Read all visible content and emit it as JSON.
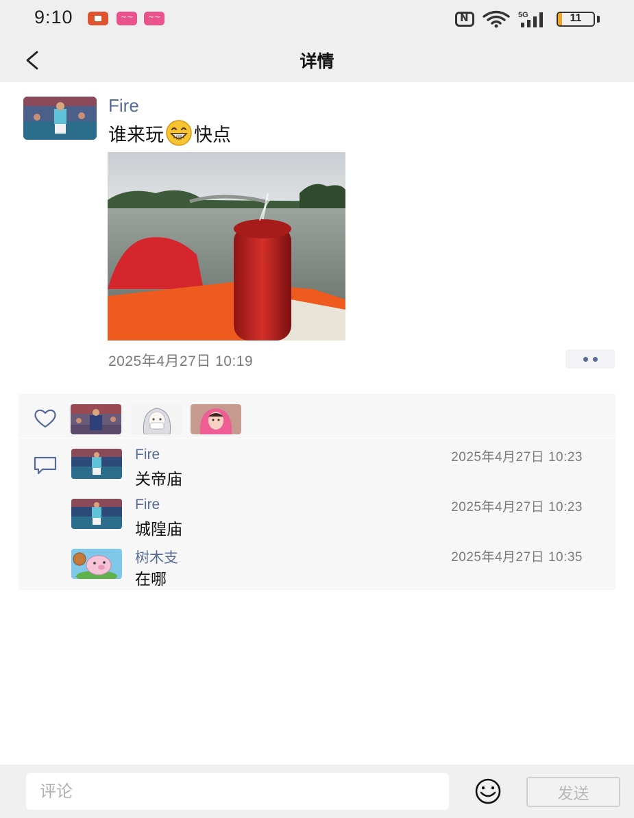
{
  "status_bar": {
    "time": "9:10",
    "network": "5G",
    "battery": {
      "level_text": "11",
      "level_percent": 11
    }
  },
  "nav": {
    "title": "详情"
  },
  "post": {
    "author": "Fire",
    "text_before": "谁来玩",
    "emoji": "grinning-emoji-icon",
    "text_after": "快点",
    "time": "2025年4月27日 10:19"
  },
  "likes": {
    "icon": "heart-icon",
    "avatars": [
      "crowd-avatar",
      "anime-avatar",
      "pink-hoodie-avatar"
    ]
  },
  "comments": [
    {
      "author": "Fire",
      "time": "2025年4月27日 10:23",
      "text": "关帝庙"
    },
    {
      "author": "Fire",
      "time": "2025年4月27日 10:23",
      "text": "城隍庙"
    },
    {
      "author": "树木支",
      "time": "2025年4月27日 10:35",
      "text": "在哪"
    }
  ],
  "input_bar": {
    "placeholder": "评论",
    "send_label": "发送"
  },
  "colors": {
    "link_blue": "#576b95",
    "bar_gray": "#efefef",
    "panel_gray": "#f7f7f7"
  }
}
